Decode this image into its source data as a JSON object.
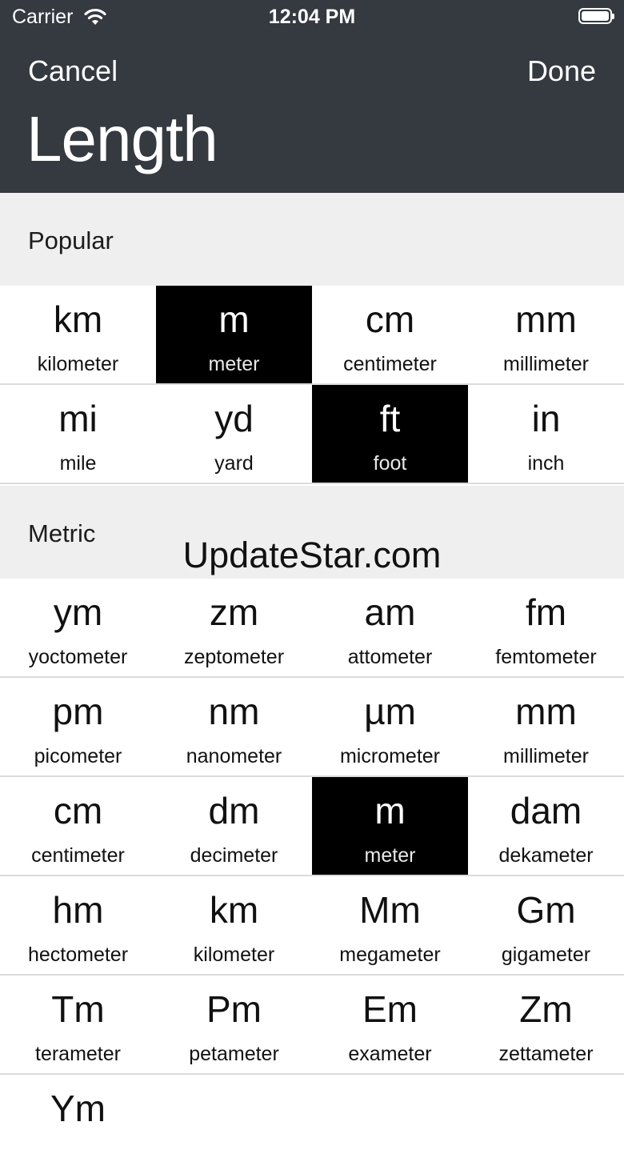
{
  "status": {
    "carrier": "Carrier",
    "time": "12:04 PM"
  },
  "nav": {
    "cancel": "Cancel",
    "done": "Done",
    "title": "Length"
  },
  "sections": [
    {
      "title": "Popular",
      "rows": [
        [
          {
            "sym": "km",
            "name": "kilometer",
            "selected": false
          },
          {
            "sym": "m",
            "name": "meter",
            "selected": true
          },
          {
            "sym": "cm",
            "name": "centimeter",
            "selected": false
          },
          {
            "sym": "mm",
            "name": "millimeter",
            "selected": false
          }
        ],
        [
          {
            "sym": "mi",
            "name": "mile",
            "selected": false
          },
          {
            "sym": "yd",
            "name": "yard",
            "selected": false
          },
          {
            "sym": "ft",
            "name": "foot",
            "selected": true
          },
          {
            "sym": "in",
            "name": "inch",
            "selected": false
          }
        ]
      ]
    },
    {
      "title": "Metric",
      "rows": [
        [
          {
            "sym": "ym",
            "name": "yoctometer",
            "selected": false
          },
          {
            "sym": "zm",
            "name": "zeptometer",
            "selected": false
          },
          {
            "sym": "am",
            "name": "attometer",
            "selected": false
          },
          {
            "sym": "fm",
            "name": "femtometer",
            "selected": false
          }
        ],
        [
          {
            "sym": "pm",
            "name": "picometer",
            "selected": false
          },
          {
            "sym": "nm",
            "name": "nanometer",
            "selected": false
          },
          {
            "sym": "µm",
            "name": "micrometer",
            "selected": false
          },
          {
            "sym": "mm",
            "name": "millimeter",
            "selected": false
          }
        ],
        [
          {
            "sym": "cm",
            "name": "centimeter",
            "selected": false
          },
          {
            "sym": "dm",
            "name": "decimeter",
            "selected": false
          },
          {
            "sym": "m",
            "name": "meter",
            "selected": true
          },
          {
            "sym": "dam",
            "name": "dekameter",
            "selected": false
          }
        ],
        [
          {
            "sym": "hm",
            "name": "hectometer",
            "selected": false
          },
          {
            "sym": "km",
            "name": "kilometer",
            "selected": false
          },
          {
            "sym": "Mm",
            "name": "megameter",
            "selected": false
          },
          {
            "sym": "Gm",
            "name": "gigameter",
            "selected": false
          }
        ],
        [
          {
            "sym": "Tm",
            "name": "terameter",
            "selected": false
          },
          {
            "sym": "Pm",
            "name": "petameter",
            "selected": false
          },
          {
            "sym": "Em",
            "name": "exameter",
            "selected": false
          },
          {
            "sym": "Zm",
            "name": "zettameter",
            "selected": false
          }
        ],
        [
          {
            "sym": "Ym",
            "name": "",
            "selected": false
          }
        ]
      ]
    }
  ],
  "watermark": "UpdateStar.com"
}
